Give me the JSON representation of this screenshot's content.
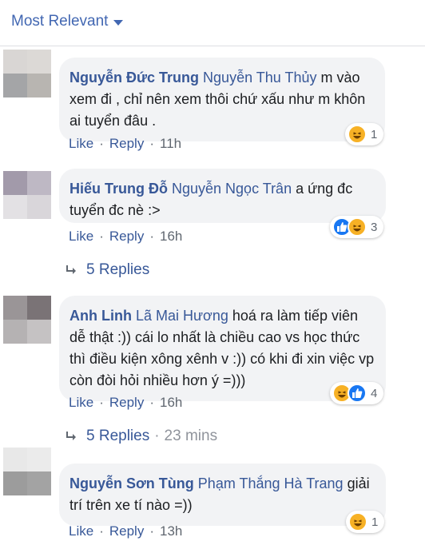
{
  "sort": {
    "label": "Most Relevant"
  },
  "comments": [
    {
      "author": "Nguyễn Đức Trung",
      "mention": "Nguyễn Thu Thủy",
      "text": "m vào xem đi , chỉ nên xem thôi chứ xấu như m khôn ai tuyển đâu .",
      "reactions": [
        "haha"
      ],
      "reaction_count": "1",
      "like_label": "Like",
      "reply_label": "Reply",
      "time": "11h"
    },
    {
      "author": "Hiếu Trung Đỗ",
      "mention": "Nguyễn Ngọc Trân",
      "text": "a ứng đc tuyển đc nè :>",
      "reactions": [
        "like",
        "haha"
      ],
      "reaction_count": "3",
      "like_label": "Like",
      "reply_label": "Reply",
      "time": "16h",
      "replies_label": "5 Replies"
    },
    {
      "author": "Anh Linh",
      "mention": "Lã Mai Hương",
      "text": "hoá ra làm tiếp viên dễ thật :)) cái lo nhất là chiều cao vs học thức thì điều kiện xông xênh v :)) có khi đi xin việc vp còn đòi hỏi nhiều hơn ý =)))",
      "reactions": [
        "haha",
        "like"
      ],
      "reaction_count": "4",
      "like_label": "Like",
      "reply_label": "Reply",
      "time": "16h",
      "replies_label": "5 Replies",
      "replies_time": "23 mins"
    },
    {
      "author": "Nguyễn Sơn Tùng",
      "mention": "Phạm Thắng Hà Trang",
      "text": "giải trí trên xe tí nào =))",
      "reactions": [
        "haha"
      ],
      "reaction_count": "1",
      "like_label": "Like",
      "reply_label": "Reply",
      "time": "13h"
    }
  ],
  "colors": {
    "link": "#385898",
    "accent": "#4267b2",
    "bubble": "#f2f3f5",
    "meta": "#606770",
    "haha": "#f7b125",
    "like": "#1877f2"
  },
  "icons": {
    "sort": "caret-down-icon",
    "reply": "reply-arrow-icon",
    "haha": "haha-reaction-icon",
    "like": "like-reaction-icon"
  }
}
